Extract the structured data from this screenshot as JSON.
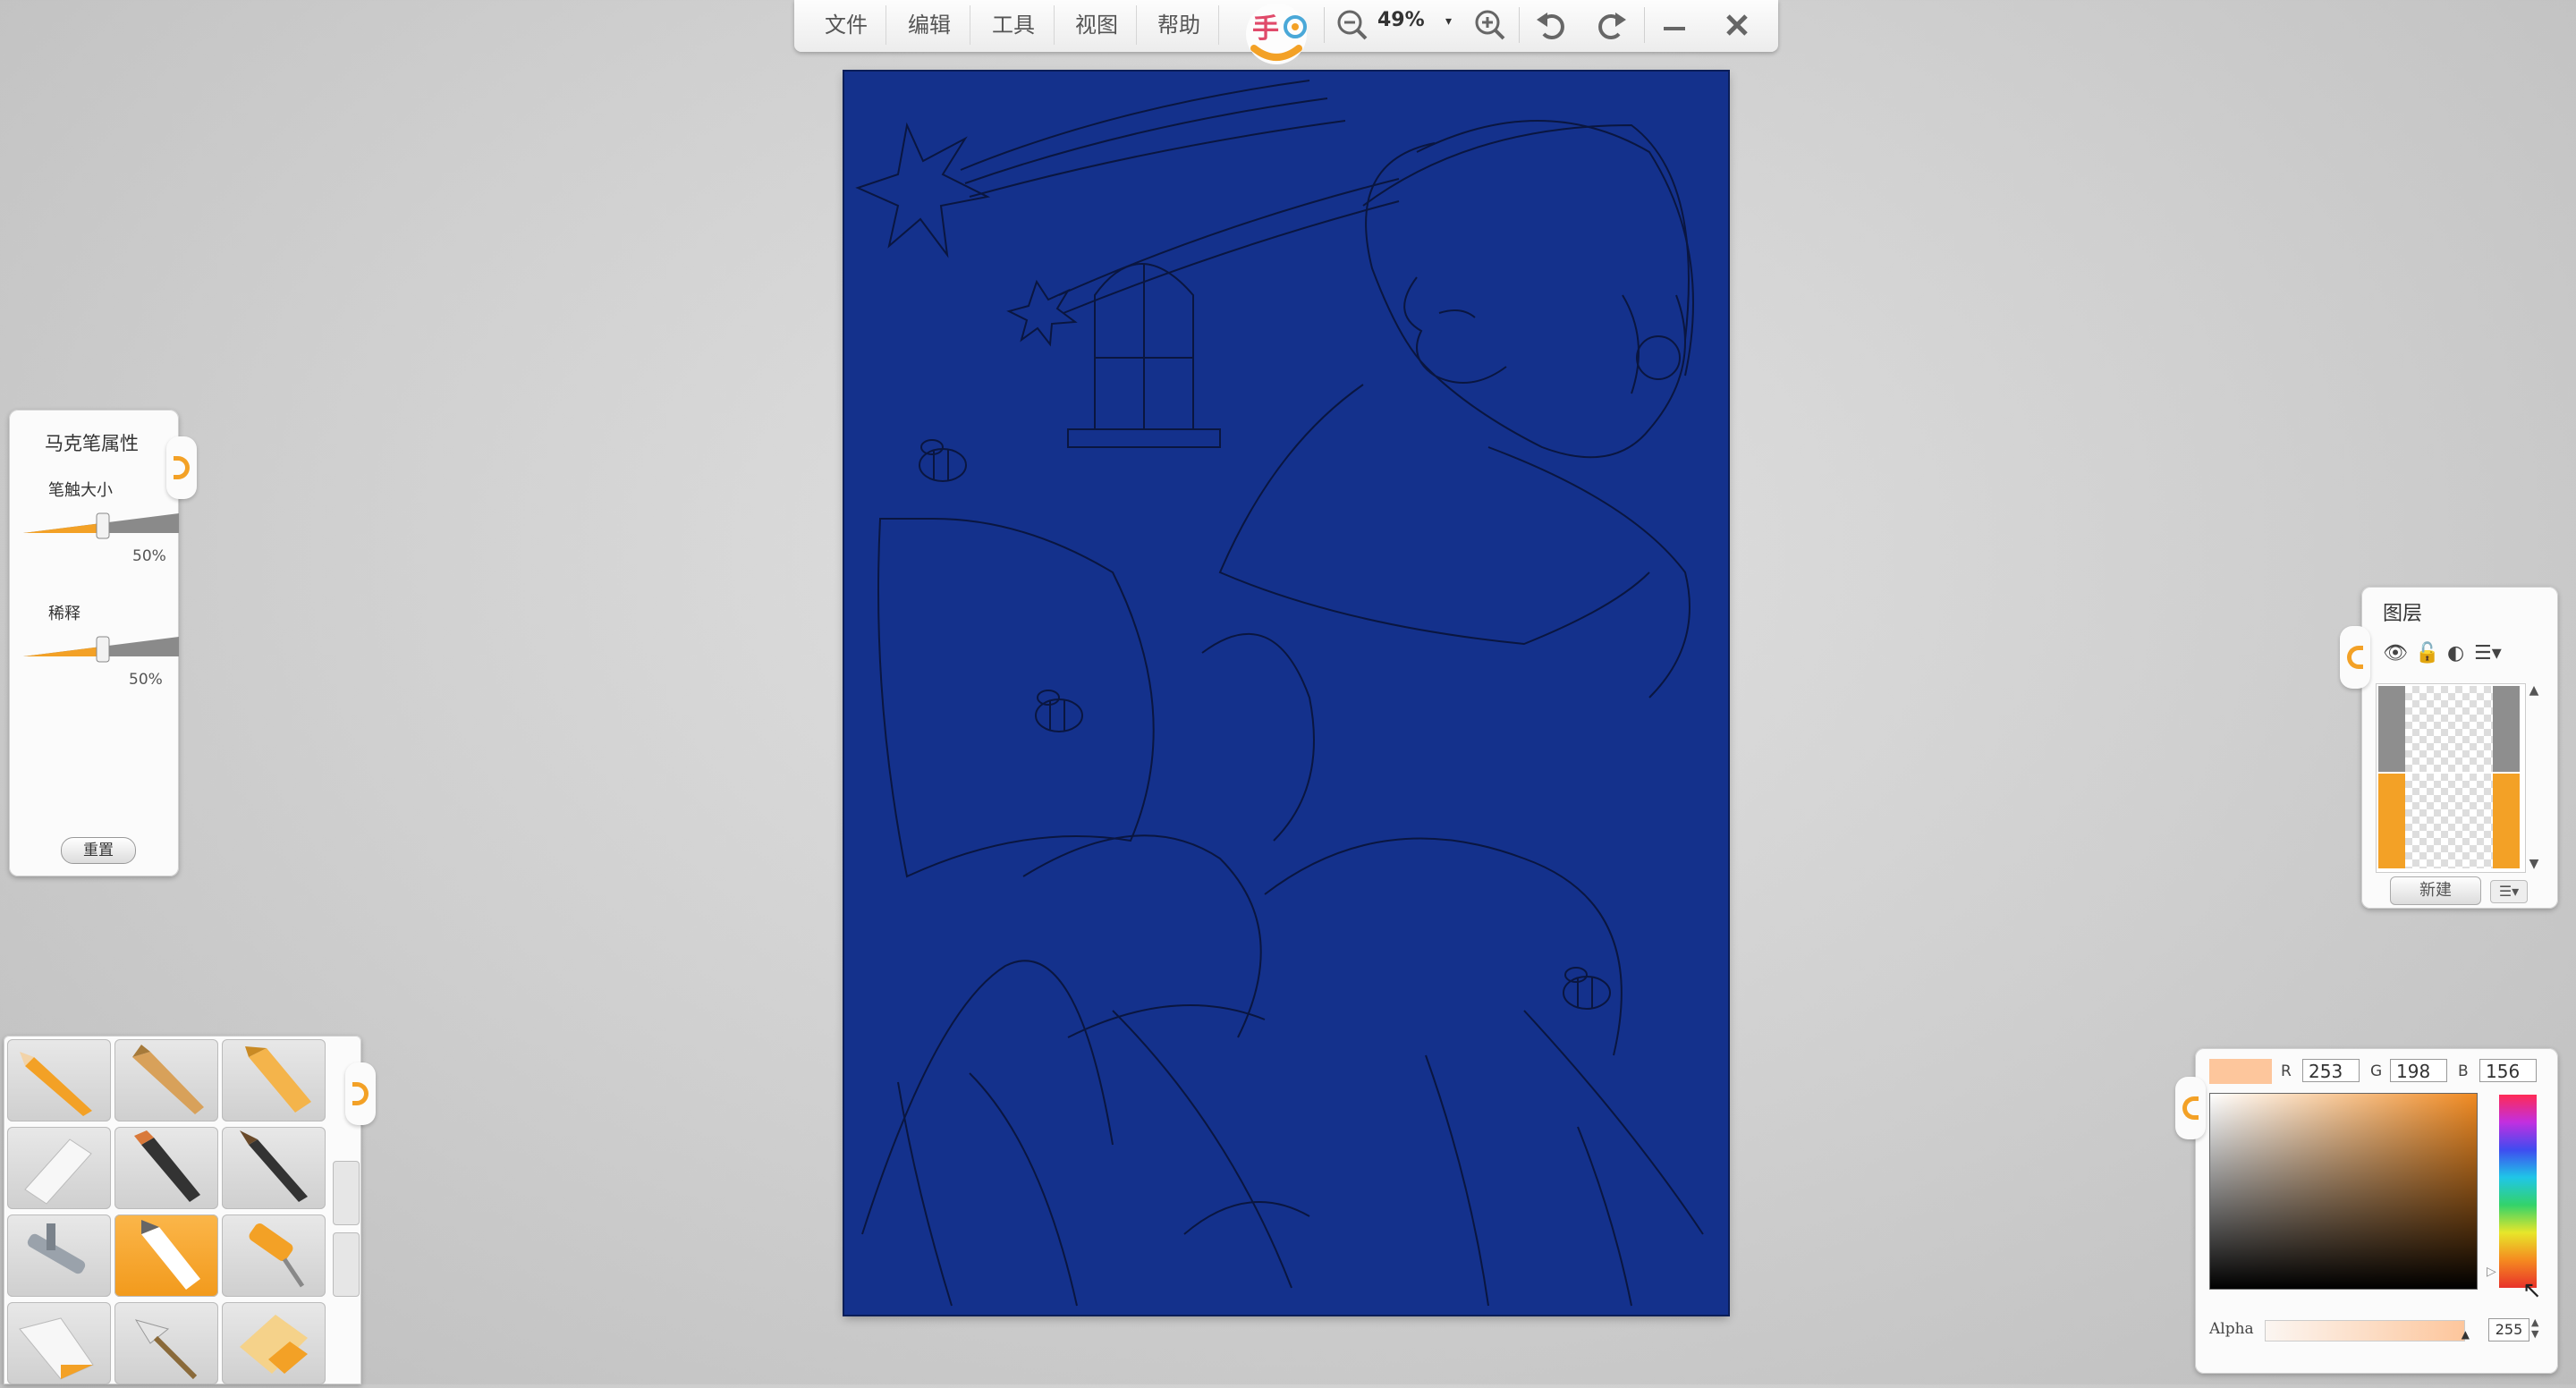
{
  "toolbar": {
    "menus": [
      "文件",
      "编辑",
      "工具",
      "视图",
      "帮助"
    ],
    "zoom": "49%"
  },
  "brush_panel": {
    "title": "马克笔属性",
    "size_label": "笔触大小",
    "size_value": "50%",
    "opacity_label": "稀释",
    "opacity_value": "50%",
    "reset_label": "重置"
  },
  "layers_panel": {
    "title": "图层",
    "new_label": "新建"
  },
  "color_panel": {
    "r_label": "R",
    "r_value": "253",
    "g_label": "G",
    "g_value": "198",
    "b_label": "B",
    "b_value": "156",
    "current_color": "#fdc69c",
    "alpha_label": "Alpha",
    "alpha_value": "255"
  },
  "tools": [
    "pencil-icon",
    "flat-brush-icon",
    "crayon-icon",
    "eraser-icon",
    "oil-brush-icon",
    "ink-brush-icon",
    "airbrush-icon",
    "marker-icon",
    "roller-icon",
    "paint-tube-icon",
    "palette-knife-icon",
    "chalk-icon"
  ],
  "active_tool": "marker-icon",
  "colors": {
    "accent": "#f3a126",
    "canvas_bg": "#14318c"
  }
}
